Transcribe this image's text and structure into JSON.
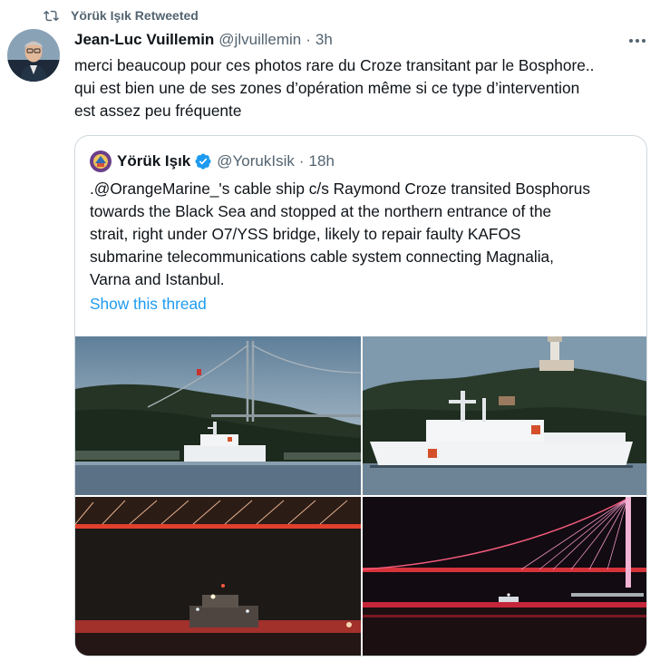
{
  "retweet": {
    "icon": "retweet-icon",
    "label": "Yörük Işık Retweeted"
  },
  "tweet": {
    "author_name": "Jean-Luc Vuillemin",
    "author_handle": "@jlvuillemin",
    "separator": "·",
    "time": "3h",
    "more_icon": "more-icon",
    "text_lines": [
      "merci beaucoup pour ces photos rare du Croze transitant par le Bosphore..",
      "qui est bien une de ses zones d’opération même si ce type d’intervention",
      "est assez peu fréquente"
    ]
  },
  "quote": {
    "author_name": "Yörük Işık",
    "verified_icon": "verified-badge-icon",
    "author_handle": "@YorukIsik",
    "separator": "·",
    "time": "18h",
    "text_lines": [
      ".@OrangeMarine_'s cable ship c/s Raymond Croze transited Bosphorus",
      "towards the Black Sea and stopped at the northern entrance of the",
      "strait, right under O7/YSS bridge, likely to repair faulty KAFOS",
      "submarine telecommunications cable system connecting Magnalia,",
      "Varna and Istanbul."
    ],
    "show_thread": "Show this thread"
  },
  "colors": {
    "text_primary": "#0f1419",
    "text_secondary": "#536471",
    "link": "#1d9bf0",
    "border": "#cfd9de"
  }
}
